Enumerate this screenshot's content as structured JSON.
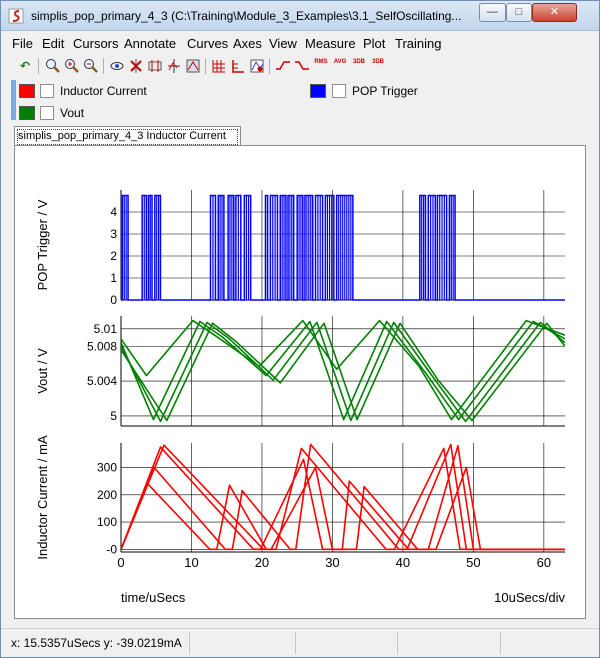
{
  "window": {
    "title": "simplis_pop_primary_4_3 (C:\\Training\\Module_3_Examples\\3.1_SelfOscillating...",
    "minimize_glyph": "—",
    "maximize_glyph": "□",
    "close_glyph": "✕"
  },
  "menu": [
    "File",
    "Edit",
    "Cursors",
    "Annotate",
    "Curves",
    "Axes",
    "View",
    "Measure",
    "Plot",
    "Training"
  ],
  "toolbar_icons": [
    "undo-icon",
    "zoom-full-icon",
    "zoom-in-icon",
    "zoom-out-icon",
    "view-icon",
    "cursor-delete-icon",
    "cursor-add-icon",
    "cursor-snap-icon",
    "cursor-ref-icon",
    "grid-icon",
    "axis-icon",
    "curve-color-icon",
    "measure-rise-icon",
    "measure-fall-icon",
    "measure-rms-icon",
    "measure-avg-icon",
    "measure-3db-low-icon",
    "measure-3db-high-icon"
  ],
  "toolbar_glyphs": {
    "undo": "↶",
    "zoom": "⊕",
    "zoom_in": "⊕",
    "zoom_out": "⊖",
    "view": "👁",
    "rms": "RMS",
    "avg": "AVG",
    "db1": "3DB",
    "db2": "3DB"
  },
  "legend": {
    "inductor_current": "Inductor Current",
    "vout": "Vout",
    "pop_trigger": "POP Trigger"
  },
  "colors": {
    "pop_trigger": "#0000ff",
    "vout": "#008000",
    "inductor_current": "#ff0000"
  },
  "tab_label": "simplis_pop_primary_4_3 Inductor Current",
  "status": {
    "text": "x: 15.5357uSecs  y: -39.0219mA"
  },
  "chart_data": [
    {
      "type": "line",
      "name": "pop-trigger",
      "ylabel": "POP Trigger / V",
      "yticks": [
        "4",
        "3",
        "2",
        "1",
        "0"
      ],
      "ytick_values": [
        4,
        3,
        2,
        1,
        0
      ],
      "ylim": [
        0,
        5
      ],
      "xlim": [
        0,
        63
      ],
      "color": "#0000ff",
      "high_intervals": [
        [
          0.2,
          1.0
        ],
        [
          3.0,
          3.6
        ],
        [
          3.9,
          4.4
        ],
        [
          4.8,
          5.6
        ],
        [
          12.7,
          13.4
        ],
        [
          13.8,
          14.6
        ],
        [
          15.2,
          16.0
        ],
        [
          16.3,
          17.0
        ],
        [
          17.5,
          18.4
        ],
        [
          20.5,
          20.8
        ],
        [
          21.2,
          22.2
        ],
        [
          22.6,
          23.4
        ],
        [
          23.7,
          24.5
        ],
        [
          25.0,
          25.8
        ],
        [
          26.1,
          27.2
        ],
        [
          27.6,
          28.6
        ],
        [
          29.0,
          30.2
        ],
        [
          30.6,
          32.9
        ],
        [
          42.4,
          43.2
        ],
        [
          43.6,
          44.6
        ],
        [
          44.9,
          46.2
        ],
        [
          46.6,
          47.4
        ]
      ],
      "grid": true
    },
    {
      "type": "line",
      "name": "vout",
      "ylabel": "Vout / V",
      "yticks": [
        "5.01",
        "5.008",
        "5.004",
        "5"
      ],
      "ytick_values": [
        5.0101,
        5.0082,
        5.0044,
        5.0006
      ],
      "ylim": [
        4.9995,
        5.0115
      ],
      "xlim": [
        0,
        63
      ],
      "color": "#008000",
      "series": [
        {
          "x": [
            0,
            3.6,
            10.2,
            13.3,
            19.6,
            25.8,
            30.6,
            36.7,
            42.3,
            46.9,
            57.5,
            63
          ],
          "y": [
            5.009,
            5.005,
            5.011,
            5.0094,
            5.006,
            5.011,
            5.0057,
            5.011,
            5.006,
            5.0002,
            5.011,
            5.0094
          ]
        },
        {
          "x": [
            0,
            4.6,
            11.2,
            14.4,
            20.6,
            26.8,
            31.6,
            37.7,
            43.3,
            47.9,
            58.5,
            63
          ],
          "y": [
            5.0086,
            5.0002,
            5.0109,
            5.0092,
            5.005,
            5.0109,
            5.0002,
            5.0109,
            5.0052,
            5.0002,
            5.0109,
            5.009
          ]
        },
        {
          "x": [
            0,
            5.6,
            12.2,
            15.4,
            21.6,
            27.8,
            32.6,
            38.7,
            44.3,
            48.9,
            59.5,
            63
          ],
          "y": [
            5.0082,
            5.0,
            5.0108,
            5.009,
            5.0045,
            5.0108,
            5.0001,
            5.0108,
            5.0048,
            5.0,
            5.0108,
            5.0086
          ]
        },
        {
          "x": [
            0,
            6.5,
            13.0,
            16.2,
            22.6,
            28.8,
            33.5,
            39.6,
            45.0,
            49.8,
            60.4,
            63
          ],
          "y": [
            5.0078,
            5.0001,
            5.0107,
            5.0088,
            5.0042,
            5.0107,
            5.0002,
            5.0107,
            5.0045,
            5.0001,
            5.0107,
            5.0082
          ]
        }
      ],
      "grid": true
    },
    {
      "type": "line",
      "name": "inductor-current",
      "ylabel": "Inductor Current / mA",
      "yticks": [
        "300",
        "200",
        "100",
        "-0"
      ],
      "ytick_values": [
        300,
        200,
        100,
        0
      ],
      "ylim": [
        -10,
        390
      ],
      "xlim": [
        0,
        63
      ],
      "xticks": [
        "0",
        "10",
        "20",
        "30",
        "40",
        "50",
        "60"
      ],
      "xtick_values": [
        0,
        10,
        20,
        30,
        40,
        50,
        60
      ],
      "xlabel": "time/uSecs",
      "xunit": "10uSecs/div",
      "color": "#ff0000",
      "series": [
        {
          "x": [
            0,
            3.8,
            12.6,
            13.6,
            15.4,
            20.6,
            22.0,
            25.6,
            37.6,
            38.8,
            45.8,
            48.1,
            60.7,
            61.6
          ],
          "y": [
            0,
            240,
            0,
            0,
            235,
            0,
            0,
            370,
            0,
            0,
            370,
            0,
            0,
            0
          ]
        },
        {
          "x": [
            0,
            4.7,
            14.8,
            15.8,
            17.2,
            24.0,
            24.8,
            26.9,
            39.4,
            40.6,
            46.8,
            49.0,
            61.8,
            63
          ],
          "y": [
            0,
            300,
            0,
            0,
            215,
            0,
            0,
            385,
            0,
            0,
            385,
            0,
            0,
            0
          ]
        },
        {
          "x": [
            0,
            5.6,
            18.8,
            19.8,
            25.9,
            28.6,
            31.4,
            32.4,
            40.8,
            43.6,
            47.8,
            50.0,
            63
          ],
          "y": [
            0,
            375,
            0,
            0,
            330,
            0,
            0,
            250,
            0,
            0,
            380,
            0,
            0
          ]
        },
        {
          "x": [
            0,
            6.1,
            20.2,
            21.3,
            27.6,
            30.0,
            33.4,
            34.5,
            42.1,
            44.7,
            49.0,
            51.0,
            63
          ],
          "y": [
            0,
            382,
            0,
            0,
            300,
            0,
            0,
            230,
            0,
            0,
            300,
            0,
            0
          ]
        }
      ],
      "grid": true
    }
  ]
}
